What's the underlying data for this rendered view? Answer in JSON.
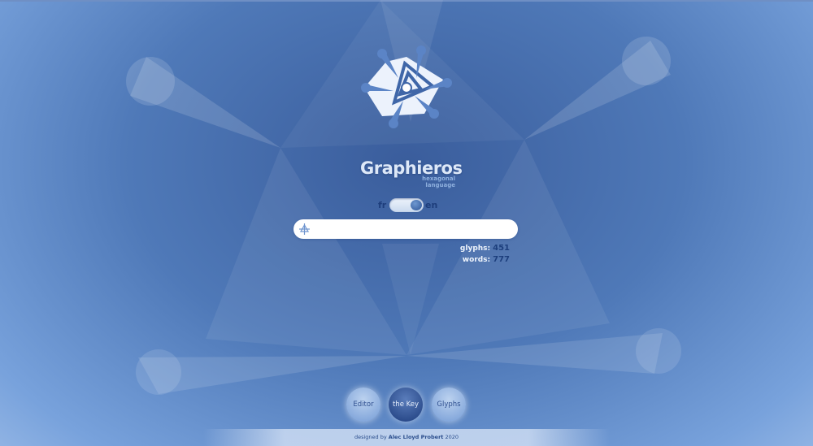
{
  "app": {
    "title": "Graphieros",
    "subtitle": "hexagonal language"
  },
  "language": {
    "left": "fr",
    "right": "en",
    "selected": "en"
  },
  "search": {
    "value": "",
    "icon": "glyph-icon"
  },
  "stats": {
    "glyphs_label": "glyphs:",
    "glyphs_value": "451",
    "words_label": "words:",
    "words_value": "777"
  },
  "nav": {
    "editor": "Editor",
    "key": "the Key",
    "glyphs": "Glyphs",
    "active": "the Key"
  },
  "footer": {
    "prefix": "designed by",
    "author": "Alec Lloyd Probert",
    "year": "2020"
  },
  "colors": {
    "accent_dark": "#2c4c8c",
    "accent_text": "#1e3e7c",
    "background_center": "#3a5d9c",
    "background_edge": "#c8dcf6"
  }
}
